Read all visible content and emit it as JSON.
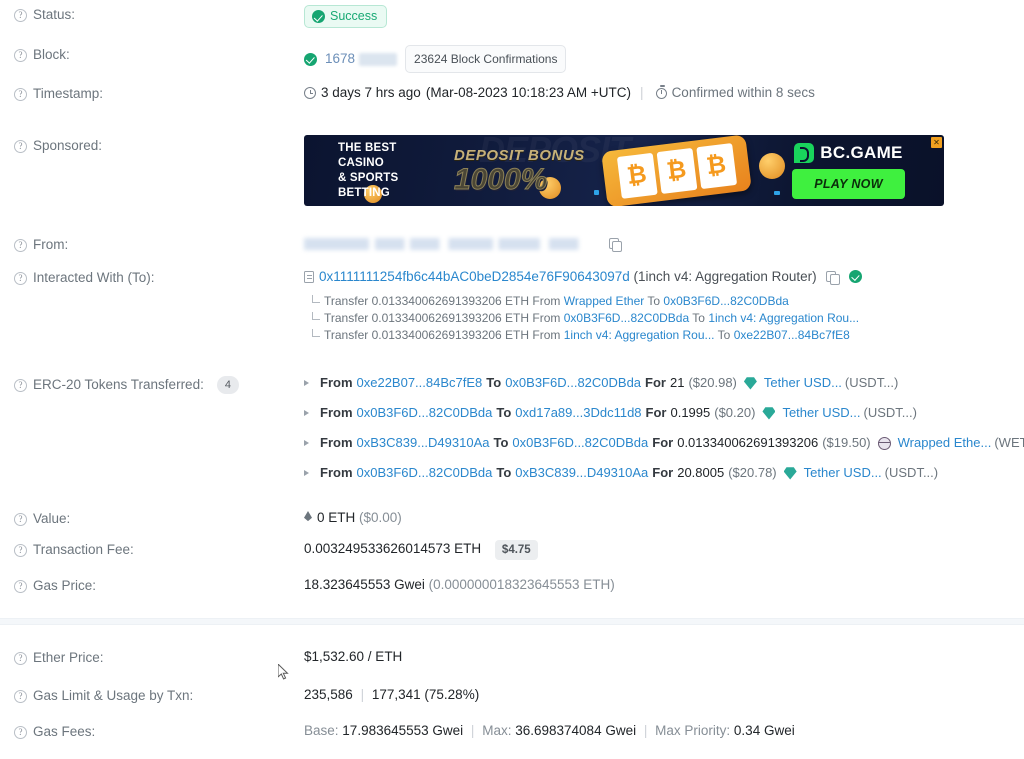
{
  "rows": {
    "status": {
      "label": "Status:",
      "value": "Success"
    },
    "block": {
      "label": "Block:",
      "number": "1678",
      "confirmations": "23624 Block Confirmations"
    },
    "timestamp": {
      "label": "Timestamp:",
      "age": "3 days 7 hrs ago",
      "exact": "(Mar-08-2023 10:18:23 AM +UTC)",
      "separator": "|",
      "confirmed": "Confirmed within 8 secs"
    },
    "sponsored": {
      "label": "Sponsored:",
      "banner": {
        "tagline_line1": "THE BEST CASINO",
        "tagline_line2": "& SPORTS BETTING",
        "deposit_bonus": "DEPOSIT BONUS",
        "percent": "1000%",
        "ghost": "DEPOSIT",
        "brand": "BC.GAME",
        "cta": "PLAY NOW",
        "close": "✕",
        "reel_symbol": "₿"
      }
    },
    "from": {
      "label": "From:",
      "address_redacted": true
    },
    "interacted_with": {
      "label": "Interacted With (To):",
      "address": "0x1111111254fb6c44bAC0beD2854e76F90643097d",
      "name_tag": "(1inch v4: Aggregation Router)",
      "transfers": [
        {
          "prefix": "Transfer",
          "amount": "0.013340062691393206 ETH",
          "from_label": "From",
          "from": "Wrapped Ether",
          "to_label": "To",
          "to": "0x0B3F6D...82C0DBda"
        },
        {
          "prefix": "Transfer",
          "amount": "0.013340062691393206 ETH",
          "from_label": "From",
          "from": "0x0B3F6D...82C0DBda",
          "to_label": "To",
          "to": "1inch v4: Aggregation Rou..."
        },
        {
          "prefix": "Transfer",
          "amount": "0.013340062691393206 ETH",
          "from_label": "From",
          "from": "1inch v4: Aggregation Rou...",
          "to_label": "To",
          "to": "0xe22B07...84Bc7fE8"
        }
      ]
    },
    "erc20": {
      "label": "ERC-20 Tokens Transferred:",
      "count": "4",
      "items": [
        {
          "from_label": "From",
          "from": "0xe22B07...84Bc7fE8",
          "to_label": "To",
          "to": "0x0B3F6D...82C0DBda",
          "for_label": "For",
          "amount": "21",
          "usd": "($20.98)",
          "token": "Tether USD...",
          "symbol": "(USDT...)",
          "icon": "tether-gem-icon"
        },
        {
          "from_label": "From",
          "from": "0x0B3F6D...82C0DBda",
          "to_label": "To",
          "to": "0xd17a89...3Ddc11d8",
          "for_label": "For",
          "amount": "0.1995",
          "usd": "($0.20)",
          "token": "Tether USD...",
          "symbol": "(USDT...)",
          "icon": "tether-gem-icon"
        },
        {
          "from_label": "From",
          "from": "0xB3C839...D49310Aa",
          "to_label": "To",
          "to": "0x0B3F6D...82C0DBda",
          "for_label": "For",
          "amount": "0.013340062691393206",
          "usd": "($19.50)",
          "token": "Wrapped Ethe...",
          "symbol": "(WETH...)",
          "icon": "weth-icon"
        },
        {
          "from_label": "From",
          "from": "0x0B3F6D...82C0DBda",
          "to_label": "To",
          "to": "0xB3C839...D49310Aa",
          "for_label": "For",
          "amount": "20.8005",
          "usd": "($20.78)",
          "token": "Tether USD...",
          "symbol": "(USDT...)",
          "icon": "tether-gem-icon"
        }
      ]
    },
    "value": {
      "label": "Value:",
      "eth": "0 ETH",
      "usd": "($0.00)"
    },
    "transaction_fee": {
      "label": "Transaction Fee:",
      "eth": "0.003249533626014573 ETH",
      "usd_badge": "$4.75"
    },
    "gas_price": {
      "label": "Gas Price:",
      "gwei": "18.323645553 Gwei",
      "eth": "(0.000000018323645553 ETH)"
    },
    "ether_price": {
      "label": "Ether Price:",
      "value": "$1,532.60 / ETH"
    },
    "gas_limit": {
      "label": "Gas Limit & Usage by Txn:",
      "limit": "235,586",
      "separator": "|",
      "used": "177,341 (75.28%)"
    },
    "gas_fees": {
      "label": "Gas Fees:",
      "base_label": "Base:",
      "base": "17.983645553 Gwei",
      "sep1": "|",
      "max_label": "Max:",
      "max": "36.698374084 Gwei",
      "sep2": "|",
      "priority_label": "Max Priority:",
      "priority": "0.34 Gwei"
    }
  },
  "colors": {
    "success": "#16a571",
    "link": "#2a87cd",
    "muted": "#6c757d",
    "tether": "#2aa998"
  }
}
